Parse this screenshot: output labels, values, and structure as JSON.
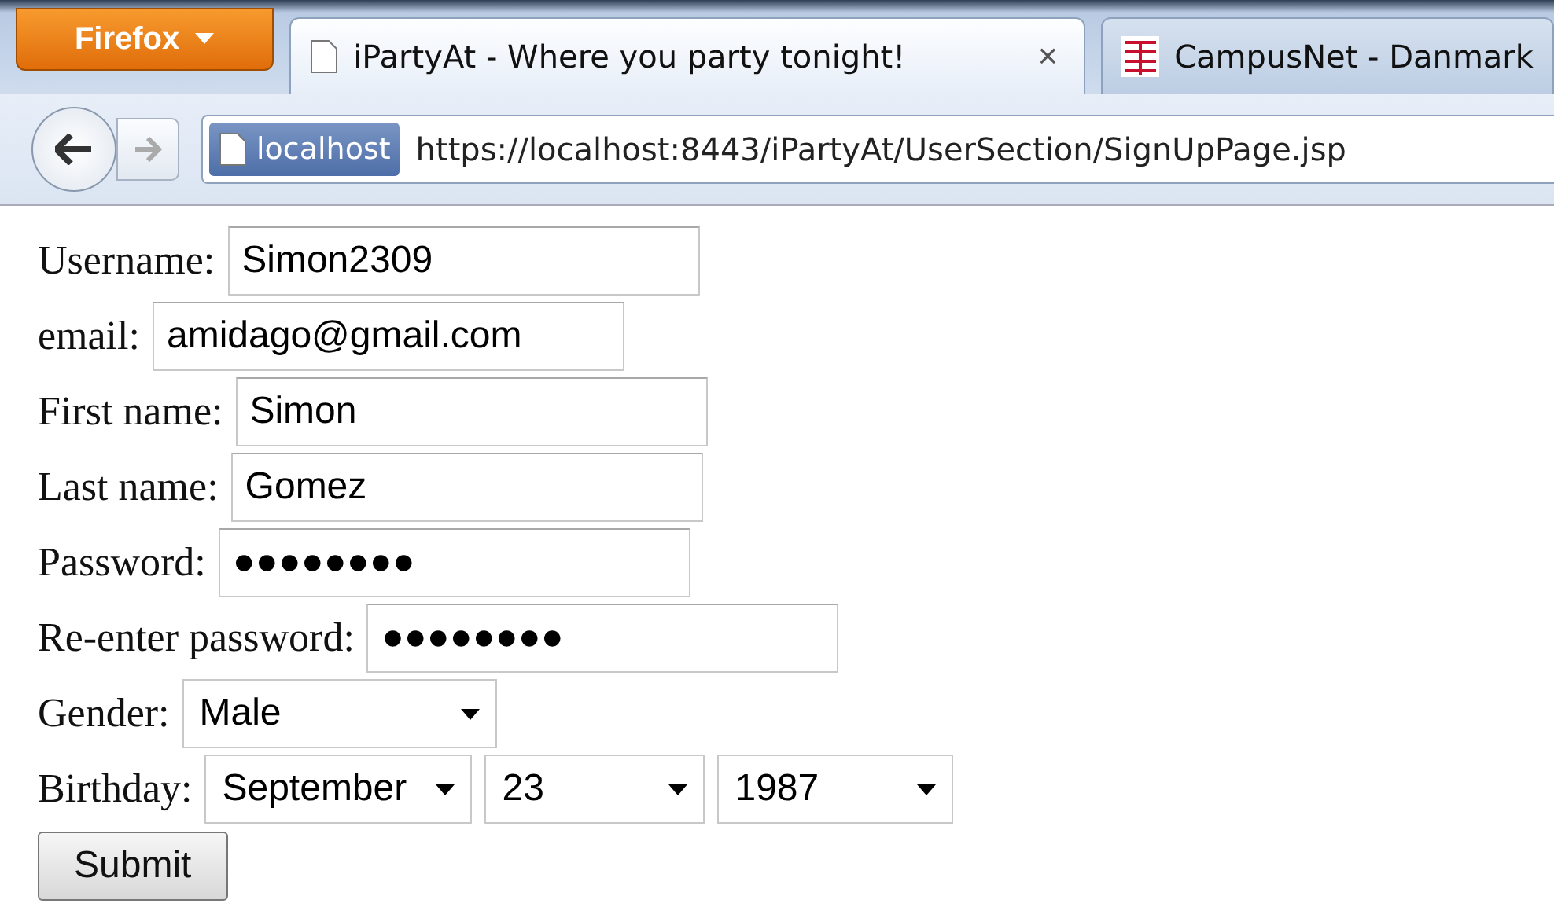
{
  "browser": {
    "menu_button": "Firefox",
    "tabs": [
      {
        "title": "iPartyAt - Where you party tonight!",
        "selected": true,
        "close": "×"
      },
      {
        "title": "CampusNet - Danmark",
        "selected": false
      }
    ],
    "identity": "localhost",
    "url": "https://localhost:8443/iPartyAt/UserSection/SignUpPage.jsp"
  },
  "form": {
    "fields": [
      {
        "kind": "text",
        "label": "Username:",
        "value": "Simon2309"
      },
      {
        "kind": "text",
        "label": "email:",
        "value": "amidago@gmail.com"
      },
      {
        "kind": "text",
        "label": "First name:",
        "value": "Simon"
      },
      {
        "kind": "text",
        "label": "Last name:",
        "value": "Gomez"
      },
      {
        "kind": "password",
        "label": "Password:",
        "value": "●●●●●●●●"
      },
      {
        "kind": "password",
        "label": "Re-enter password:",
        "value": "●●●●●●●●"
      },
      {
        "kind": "select",
        "label": "Gender:",
        "values": [
          "Male"
        ]
      },
      {
        "kind": "select",
        "label": "Birthday:",
        "values": [
          "September",
          "23",
          "1987"
        ]
      }
    ],
    "submit": "Submit"
  }
}
